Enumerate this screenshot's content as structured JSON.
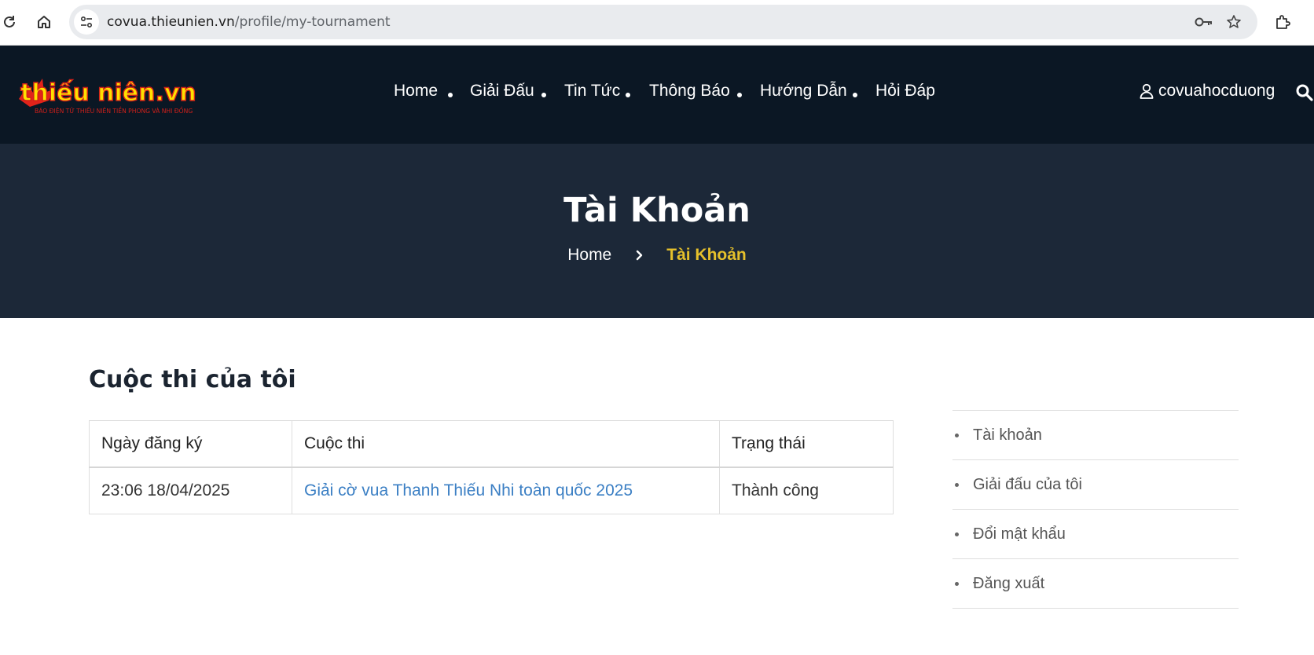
{
  "browser": {
    "url_host": "covua.thieunien.vn",
    "url_path": "/profile/my-tournament"
  },
  "header": {
    "logo_text": "thiếu niên.vn",
    "logo_tagline": "BÁO ĐIỆN TỬ THIẾU NIÊN TIỀN PHONG VÀ NHI ĐỒNG",
    "nav": [
      "Home",
      "Giải Đấu",
      "Tin Tức",
      "Thông Báo",
      "Hướng Dẫn",
      "Hỏi Đáp"
    ],
    "username": "covuahocduong"
  },
  "hero": {
    "title": "Tài Khoản",
    "breadcrumb_home": "Home",
    "breadcrumb_current": "Tài Khoản"
  },
  "main": {
    "title": "Cuộc thi của tôi",
    "table": {
      "headers": [
        "Ngày đăng ký",
        "Cuộc thi",
        "Trạng thái"
      ],
      "rows": [
        {
          "date": "23:06 18/04/2025",
          "tournament": "Giải cờ vua Thanh Thiếu Nhi toàn quốc 2025",
          "status": "Thành công"
        }
      ]
    }
  },
  "sidebar": {
    "items": [
      "Tài khoản",
      "Giải đấu của tôi",
      "Đổi mật khẩu",
      "Đăng xuất"
    ]
  },
  "colors": {
    "header_bg": "#0b1724",
    "hero_bg": "#1c2838",
    "accent": "#e5c02b",
    "link": "#3b7fc4"
  }
}
